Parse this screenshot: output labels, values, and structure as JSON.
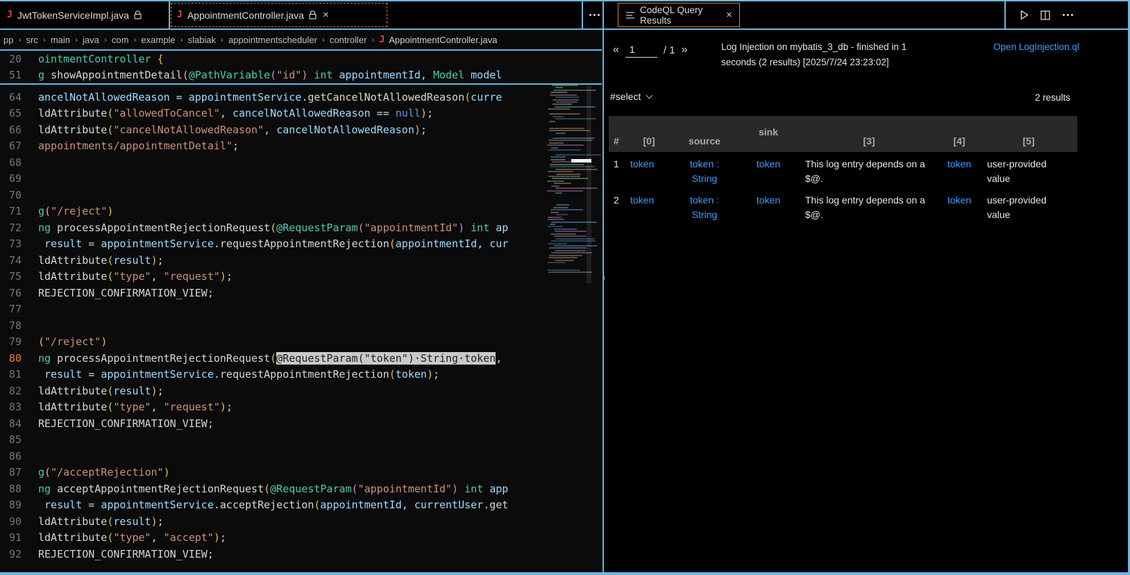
{
  "tabs": {
    "left": [
      {
        "label": "JwtTokenServiceImpl.java"
      },
      {
        "label": "AppointmentController.java"
      }
    ],
    "right": {
      "label": "CodeQL Query Results"
    },
    "close_glyph": "×"
  },
  "breadcrumb": {
    "items": [
      "pp",
      "src",
      "main",
      "java",
      "com",
      "example",
      "slabiak",
      "appointmentscheduler",
      "controller"
    ],
    "separator": "›",
    "file": "AppointmentController.java",
    "file_icon": "J"
  },
  "editor": {
    "sticky_lines": [
      {
        "num": "20",
        "tokens": [
          [
            "typ",
            "ointmentController"
          ],
          [
            "pun",
            " "
          ],
          [
            "br1",
            "{"
          ]
        ]
      },
      {
        "num": "51",
        "tokens": [
          [
            "typ",
            "g"
          ],
          [
            "pun",
            " "
          ],
          [
            "met",
            "showAppointmentDetail"
          ],
          [
            "br1",
            "("
          ],
          [
            "typ",
            "@PathVariable"
          ],
          [
            "br2",
            "("
          ],
          [
            "str",
            "\"id\""
          ],
          [
            "br2",
            ")"
          ],
          [
            "pun",
            " "
          ],
          [
            "typ",
            "int"
          ],
          [
            "pun",
            " "
          ],
          [
            "var",
            "appointmentId"
          ],
          [
            "pun",
            ", "
          ],
          [
            "typ",
            "Model"
          ],
          [
            "pun",
            " "
          ],
          [
            "var",
            "model"
          ]
        ]
      }
    ],
    "lines": [
      {
        "num": "64",
        "tokens": [
          [
            "var",
            "ancelNotAllowedReason"
          ],
          [
            "pun",
            " = "
          ],
          [
            "var",
            "appointmentService"
          ],
          [
            "pun",
            "."
          ],
          [
            "met",
            "getCancelNotAllowedReason"
          ],
          [
            "br1",
            "("
          ],
          [
            "var",
            "curre"
          ]
        ]
      },
      {
        "num": "65",
        "tokens": [
          [
            "met",
            "ldAttribute"
          ],
          [
            "br1",
            "("
          ],
          [
            "str",
            "\"allowedToCancel\""
          ],
          [
            "pun",
            ", "
          ],
          [
            "var",
            "cancelNotAllowedReason"
          ],
          [
            "pun",
            " == "
          ],
          [
            "kw",
            "null"
          ],
          [
            "br1",
            ")"
          ],
          [
            "pun",
            ";"
          ]
        ]
      },
      {
        "num": "66",
        "tokens": [
          [
            "met",
            "ldAttribute"
          ],
          [
            "br1",
            "("
          ],
          [
            "str",
            "\"cancelNotAllowedReason\""
          ],
          [
            "pun",
            ", "
          ],
          [
            "var",
            "cancelNotAllowedReason"
          ],
          [
            "br1",
            ")"
          ],
          [
            "pun",
            ";"
          ]
        ]
      },
      {
        "num": "67",
        "tokens": [
          [
            "str",
            "appointments/appointmentDetail\""
          ],
          [
            "pun",
            ";"
          ]
        ]
      },
      {
        "num": "68",
        "tokens": []
      },
      {
        "num": "69",
        "tokens": []
      },
      {
        "num": "70",
        "tokens": []
      },
      {
        "num": "71",
        "tokens": [
          [
            "typ",
            "g"
          ],
          [
            "br1",
            "("
          ],
          [
            "str",
            "\"/reject\""
          ],
          [
            "br1",
            ")"
          ]
        ]
      },
      {
        "num": "72",
        "tokens": [
          [
            "typ",
            "ng"
          ],
          [
            "pun",
            " "
          ],
          [
            "met",
            "processAppointmentRejectionRequest"
          ],
          [
            "br1",
            "("
          ],
          [
            "typ",
            "@RequestParam"
          ],
          [
            "br2",
            "("
          ],
          [
            "str",
            "\"appointmentId\""
          ],
          [
            "br2",
            ")"
          ],
          [
            "pun",
            " "
          ],
          [
            "typ",
            "int"
          ],
          [
            "pun",
            " "
          ],
          [
            "var",
            "ap"
          ]
        ]
      },
      {
        "num": "73",
        "tokens": [
          [
            "pun",
            " "
          ],
          [
            "var",
            "result"
          ],
          [
            "pun",
            " = "
          ],
          [
            "var",
            "appointmentService"
          ],
          [
            "pun",
            "."
          ],
          [
            "met",
            "requestAppointmentRejection"
          ],
          [
            "br1",
            "("
          ],
          [
            "var",
            "appointmentId"
          ],
          [
            "pun",
            ", "
          ],
          [
            "var",
            "cur"
          ]
        ]
      },
      {
        "num": "74",
        "tokens": [
          [
            "met",
            "ldAttribute"
          ],
          [
            "br1",
            "("
          ],
          [
            "var",
            "result"
          ],
          [
            "br1",
            ")"
          ],
          [
            "pun",
            ";"
          ]
        ]
      },
      {
        "num": "75",
        "tokens": [
          [
            "met",
            "ldAttribute"
          ],
          [
            "br1",
            "("
          ],
          [
            "str",
            "\"type\""
          ],
          [
            "pun",
            ", "
          ],
          [
            "str",
            "\"request\""
          ],
          [
            "br1",
            ")"
          ],
          [
            "pun",
            ";"
          ]
        ]
      },
      {
        "num": "76",
        "tokens": [
          [
            "con",
            "REJECTION_CONFIRMATION_VIEW;"
          ]
        ]
      },
      {
        "num": "77",
        "tokens": []
      },
      {
        "num": "78",
        "tokens": []
      },
      {
        "num": "79",
        "tokens": [
          [
            "br1",
            "("
          ],
          [
            "str",
            "\"/reject\""
          ],
          [
            "br1",
            ")"
          ]
        ]
      },
      {
        "num": "80",
        "active": true,
        "tokens": [
          [
            "typ",
            "ng"
          ],
          [
            "pun",
            " "
          ],
          [
            "met",
            "processAppointmentRejectionRequest"
          ],
          [
            "br1",
            "("
          ],
          [
            "sel",
            "@RequestParam(\"token\")·String·token"
          ],
          [
            "pun",
            ","
          ]
        ]
      },
      {
        "num": "81",
        "tokens": [
          [
            "pun",
            " "
          ],
          [
            "var",
            "result"
          ],
          [
            "pun",
            " = "
          ],
          [
            "var",
            "appointmentService"
          ],
          [
            "pun",
            "."
          ],
          [
            "met",
            "requestAppointmentRejection"
          ],
          [
            "br1",
            "("
          ],
          [
            "var",
            "token"
          ],
          [
            "br1",
            ")"
          ],
          [
            "pun",
            ";"
          ]
        ]
      },
      {
        "num": "82",
        "tokens": [
          [
            "met",
            "ldAttribute"
          ],
          [
            "br1",
            "("
          ],
          [
            "var",
            "result"
          ],
          [
            "br1",
            ")"
          ],
          [
            "pun",
            ";"
          ]
        ]
      },
      {
        "num": "83",
        "tokens": [
          [
            "met",
            "ldAttribute"
          ],
          [
            "br1",
            "("
          ],
          [
            "str",
            "\"type\""
          ],
          [
            "pun",
            ", "
          ],
          [
            "str",
            "\"request\""
          ],
          [
            "br1",
            ")"
          ],
          [
            "pun",
            ";"
          ]
        ]
      },
      {
        "num": "84",
        "tokens": [
          [
            "con",
            "REJECTION_CONFIRMATION_VIEW;"
          ]
        ]
      },
      {
        "num": "85",
        "tokens": []
      },
      {
        "num": "86",
        "tokens": []
      },
      {
        "num": "87",
        "tokens": [
          [
            "typ",
            "g"
          ],
          [
            "br1",
            "("
          ],
          [
            "str",
            "\"/acceptRejection\""
          ],
          [
            "br1",
            ")"
          ]
        ]
      },
      {
        "num": "88",
        "tokens": [
          [
            "typ",
            "ng"
          ],
          [
            "pun",
            " "
          ],
          [
            "met",
            "acceptAppointmentRejectionRequest"
          ],
          [
            "br1",
            "("
          ],
          [
            "typ",
            "@RequestParam"
          ],
          [
            "br2",
            "("
          ],
          [
            "str",
            "\"appointmentId\""
          ],
          [
            "br2",
            ")"
          ],
          [
            "pun",
            " "
          ],
          [
            "typ",
            "int"
          ],
          [
            "pun",
            " "
          ],
          [
            "var",
            "app"
          ]
        ]
      },
      {
        "num": "89",
        "tokens": [
          [
            "pun",
            " "
          ],
          [
            "var",
            "result"
          ],
          [
            "pun",
            " = "
          ],
          [
            "var",
            "appointmentService"
          ],
          [
            "pun",
            "."
          ],
          [
            "met",
            "acceptRejection"
          ],
          [
            "br1",
            "("
          ],
          [
            "var",
            "appointmentId"
          ],
          [
            "pun",
            ", "
          ],
          [
            "var",
            "currentUser"
          ],
          [
            "pun",
            "."
          ],
          [
            "met",
            "get"
          ]
        ]
      },
      {
        "num": "90",
        "tokens": [
          [
            "met",
            "ldAttribute"
          ],
          [
            "br1",
            "("
          ],
          [
            "var",
            "result"
          ],
          [
            "br1",
            ")"
          ],
          [
            "pun",
            ";"
          ]
        ]
      },
      {
        "num": "91",
        "tokens": [
          [
            "met",
            "ldAttribute"
          ],
          [
            "br1",
            "("
          ],
          [
            "str",
            "\"type\""
          ],
          [
            "pun",
            ", "
          ],
          [
            "str",
            "\"accept\""
          ],
          [
            "br1",
            ")"
          ],
          [
            "pun",
            ";"
          ]
        ]
      },
      {
        "num": "92",
        "tokens": [
          [
            "con",
            "REJECTION_CONFIRMATION_VIEW;"
          ]
        ]
      }
    ]
  },
  "results_panel": {
    "pagination": {
      "first": "«",
      "page": "1",
      "of": "/ 1",
      "last": "»"
    },
    "status": "Log Injection on mybatis_3_db - finished in 1 seconds (2 results) [2025/7/24 23:23:02]",
    "open_link": "Open LogInjection.ql",
    "select_label": "#select",
    "results_count": "2 results",
    "table": {
      "headers": [
        "#",
        "[0]",
        "source",
        "sink",
        "[3]",
        "[4]",
        "[5]"
      ],
      "link_columns": [
        1,
        2,
        3,
        5
      ],
      "rows": [
        [
          "1",
          "token",
          "token : String",
          "token",
          "This log entry depends on a $@.",
          "token",
          "user-provided value"
        ],
        [
          "2",
          "token",
          "token : String",
          "token",
          "This log entry depends on a $@.",
          "token",
          "user-provided value"
        ]
      ]
    }
  },
  "colors": {
    "accent_border": "#6cb6de",
    "focus_tab_border": "#d9822b",
    "link_blue": "#3d9eff",
    "java_icon_red": "#e14a3f",
    "active_line_number": "#e0813d",
    "selection_bg": "#c9c9c9"
  }
}
